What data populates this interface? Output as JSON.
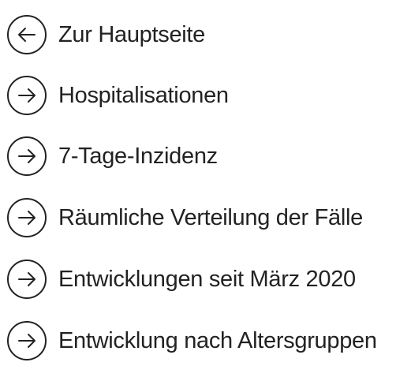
{
  "nav": {
    "items": [
      {
        "label": "Zur Hauptseite",
        "icon": "arrow-left-circle-icon"
      },
      {
        "label": "Hospitalisationen",
        "icon": "arrow-right-circle-icon"
      },
      {
        "label": "7-Tage-Inzidenz",
        "icon": "arrow-right-circle-icon"
      },
      {
        "label": "Räumliche Verteilung der Fälle",
        "icon": "arrow-right-circle-icon"
      },
      {
        "label": "Entwicklungen seit März 2020",
        "icon": "arrow-right-circle-icon"
      },
      {
        "label": "Entwicklung nach Altersgruppen",
        "icon": "arrow-right-circle-icon"
      }
    ]
  },
  "colors": {
    "text": "#222222",
    "icon_stroke": "#222222",
    "background": "#ffffff"
  }
}
